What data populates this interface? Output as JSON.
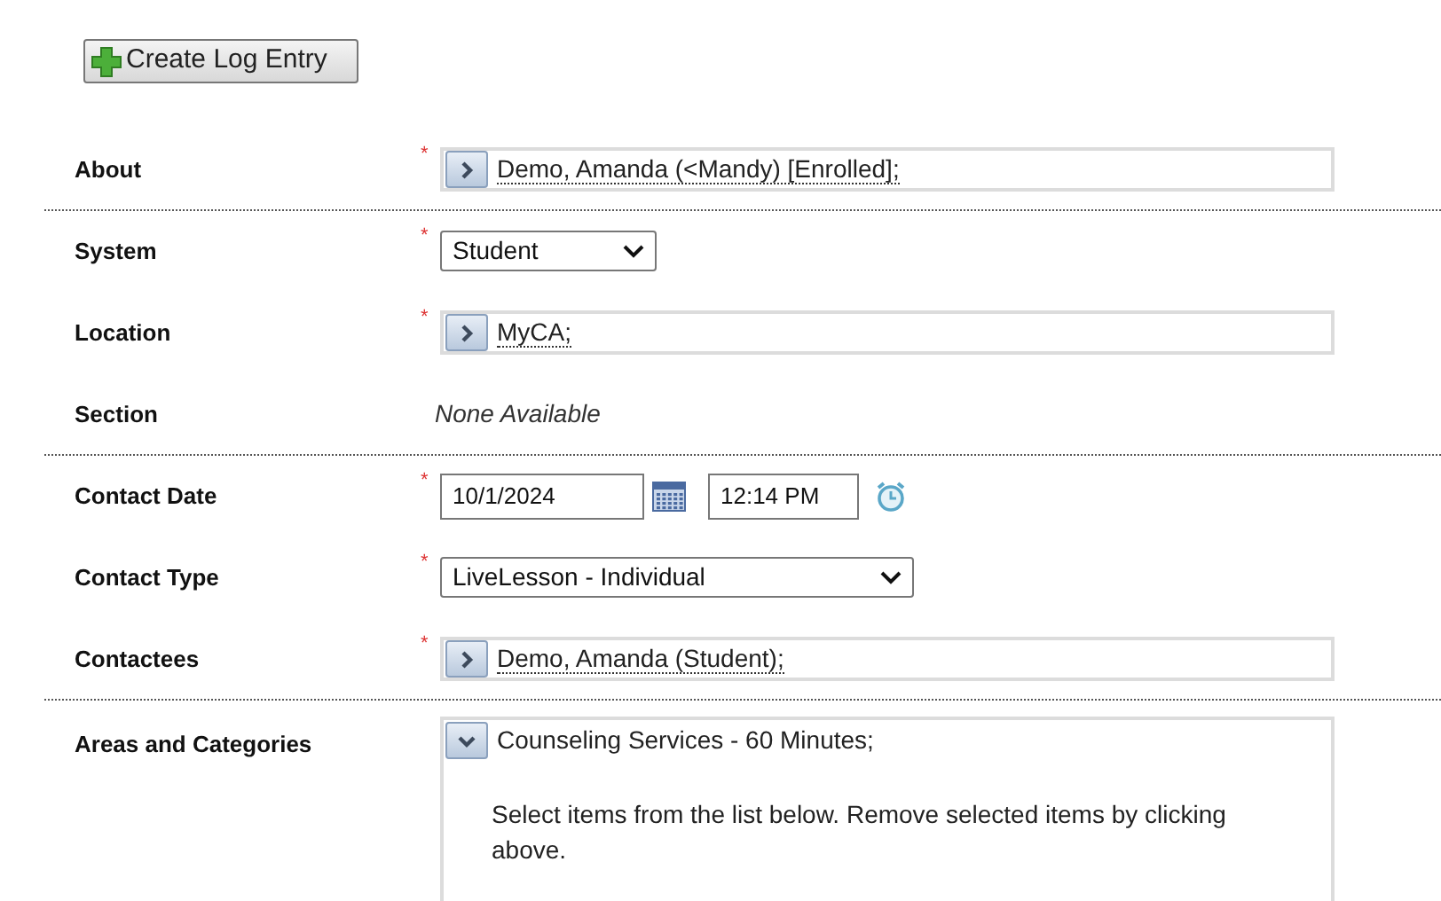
{
  "create_button": {
    "label": "Create Log Entry"
  },
  "rows": [
    {
      "label": "About",
      "kind": "picker",
      "required_mark": "*",
      "value": "Demo, Amanda (<Mandy) [Enrolled];",
      "divider_after": true
    },
    {
      "label": "System",
      "kind": "select",
      "required_mark": "*",
      "value": "Student",
      "divider_after": false
    },
    {
      "label": "Location",
      "kind": "picker",
      "required_mark": "*",
      "value": "MyCA;",
      "divider_after": false
    },
    {
      "label": "Section",
      "kind": "text",
      "value": "None Available",
      "divider_after": true
    },
    {
      "label": "Contact Date",
      "kind": "datetime",
      "required_mark": "*",
      "date": "10/1/2024",
      "time": "12:14 PM",
      "divider_after": false
    },
    {
      "label": "Contact Type",
      "kind": "select",
      "required_mark": "*",
      "value": "LiveLesson - Individual",
      "divider_after": false
    },
    {
      "label": "Contactees",
      "kind": "picker",
      "required_mark": "*",
      "value": "Demo, Amanda (Student);",
      "divider_after": true
    },
    {
      "label": "Areas and Categories",
      "kind": "areas",
      "value": "Counseling Services - 60 Minutes;",
      "hint": "Select items from the list below. Remove selected items by clicking above."
    }
  ]
}
